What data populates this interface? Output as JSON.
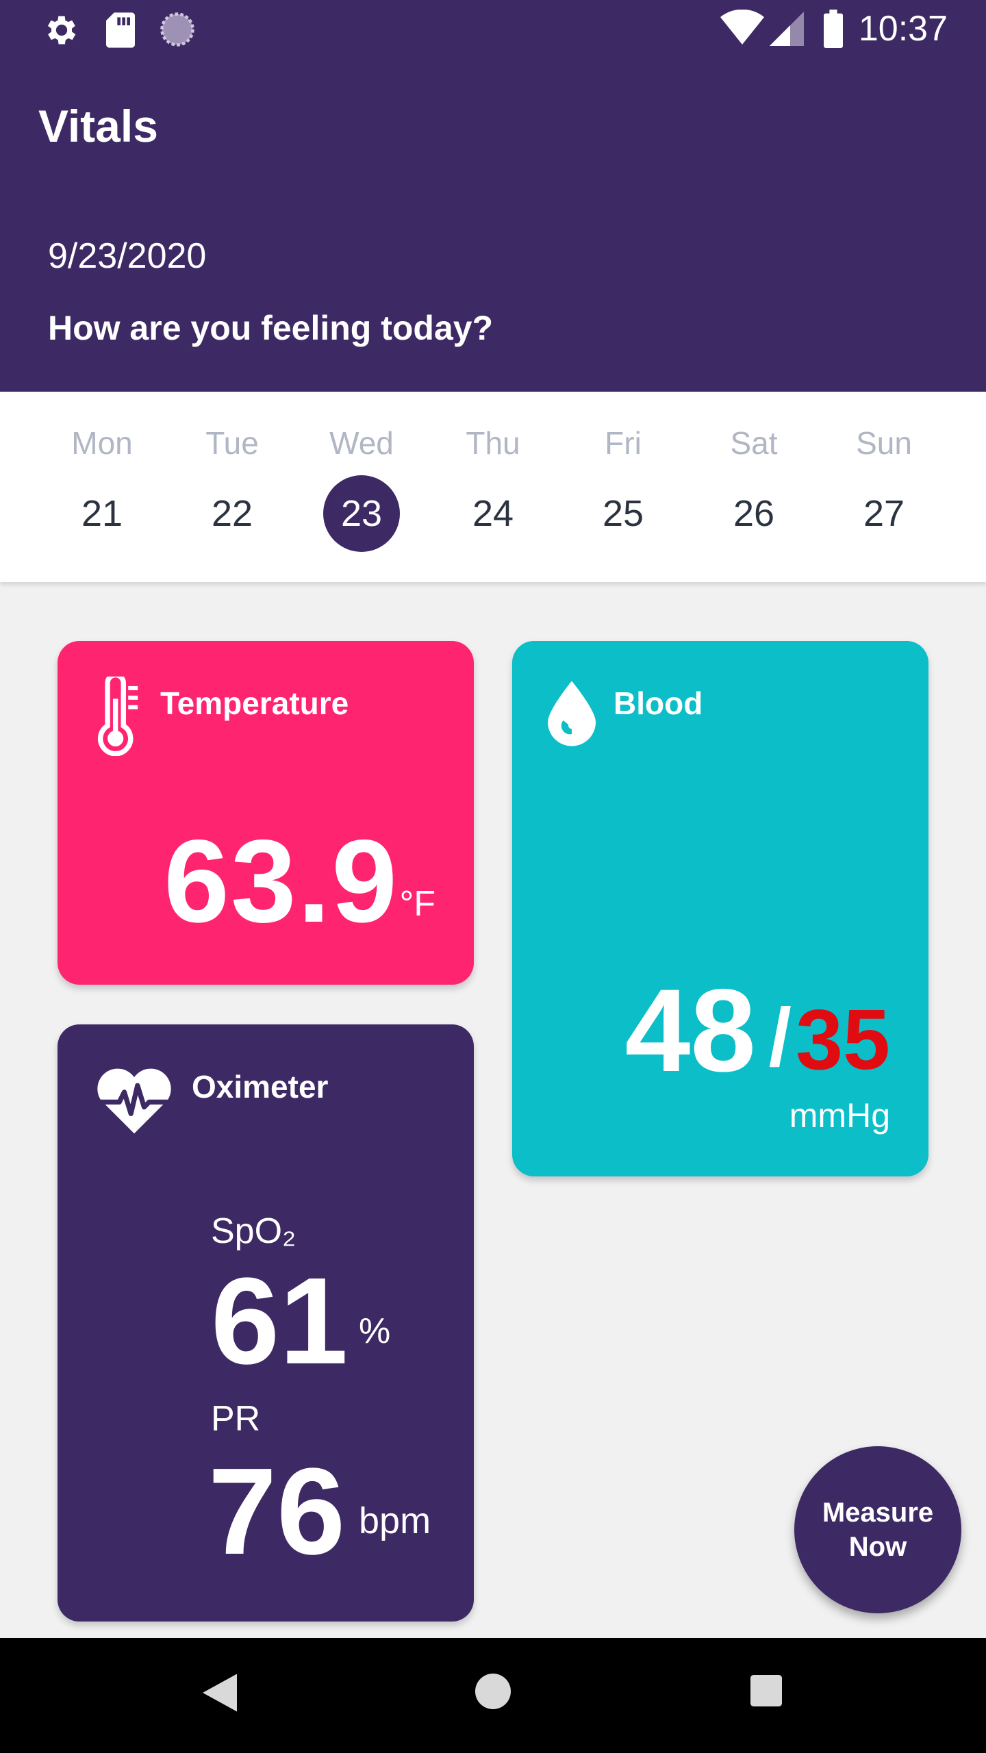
{
  "status_bar": {
    "time": "10:37",
    "left_icons": [
      "gear-icon",
      "sd-card-icon",
      "sync-circle-icon"
    ],
    "right_icons": [
      "wifi-icon",
      "signal-icon",
      "battery-icon"
    ]
  },
  "app_bar": {
    "title": "Vitals"
  },
  "header": {
    "date": "9/23/2020",
    "question": "How are you feeling today?"
  },
  "week": {
    "days": [
      {
        "name": "Mon",
        "num": "21"
      },
      {
        "name": "Tue",
        "num": "22"
      },
      {
        "name": "Wed",
        "num": "23",
        "selected": true
      },
      {
        "name": "Thu",
        "num": "24"
      },
      {
        "name": "Fri",
        "num": "25"
      },
      {
        "name": "Sat",
        "num": "26"
      },
      {
        "name": "Sun",
        "num": "27"
      }
    ]
  },
  "cards": {
    "temperature": {
      "title": "Temperature",
      "value": "63.9",
      "unit": "°F",
      "color": "#ff2470",
      "icon": "thermometer-icon"
    },
    "blood": {
      "title": "Blood",
      "systolic": "48",
      "separator": "/",
      "diastolic": "35",
      "unit": "mmHg",
      "color": "#0bbec8",
      "diastolic_color": "#e00c12",
      "icon": "drop-icon"
    },
    "oximeter": {
      "title": "Oximeter",
      "spo2_label": "SpO₂",
      "spo2_value": "61",
      "spo2_unit": "%",
      "pr_label": "PR",
      "pr_value": "76",
      "pr_unit": "bpm",
      "color": "#3d2964",
      "icon": "heart-pulse-icon"
    }
  },
  "fab": {
    "label_line1": "Measure",
    "label_line2": "Now"
  },
  "nav_bar": {
    "buttons": [
      "back-icon",
      "home-icon",
      "recents-icon"
    ]
  },
  "theme": {
    "primary": "#3d2964",
    "background": "#f1f1f1"
  }
}
